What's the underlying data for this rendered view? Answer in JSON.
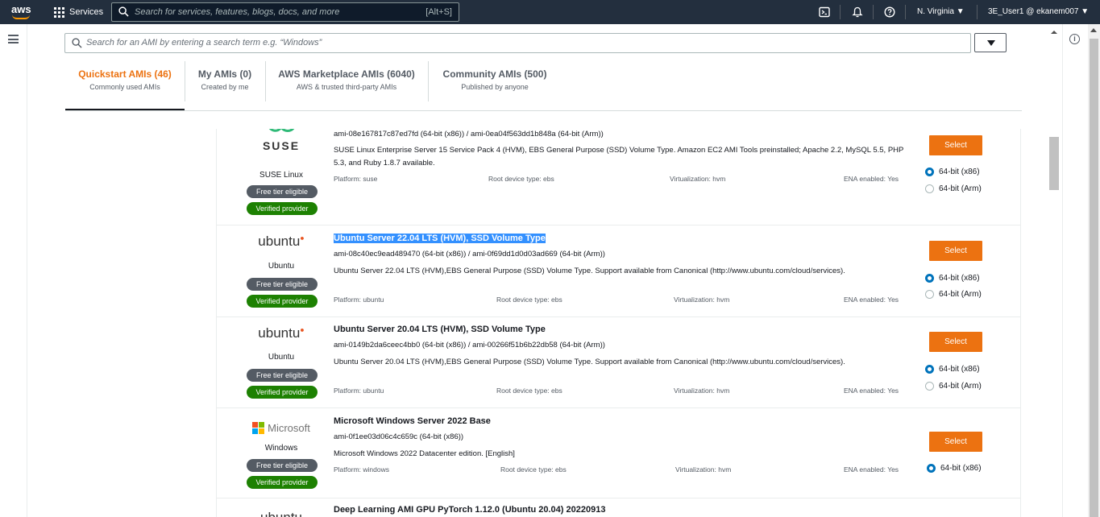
{
  "nav": {
    "services_label": "Services",
    "search_placeholder": "Search for services, features, blogs, docs, and more",
    "search_shortcut": "[Alt+S]",
    "region": "N. Virginia",
    "user": "3E_User1 @ ekanem007",
    "logo_text": "aws"
  },
  "ami_search": {
    "placeholder": "Search for an AMI by entering a search term e.g. “Windows”"
  },
  "tabs": [
    {
      "title": "Quickstart AMIs (46)",
      "subtitle": "Commonly used AMIs"
    },
    {
      "title": "My AMIs (0)",
      "subtitle": "Created by me"
    },
    {
      "title": "AWS Marketplace AMIs (6040)",
      "subtitle": "AWS & trusted third-party AMIs"
    },
    {
      "title": "Community AMIs (500)",
      "subtitle": "Published by anyone"
    }
  ],
  "amis": [
    {
      "logo_text": "SUSE",
      "os": "SUSE Linux",
      "badges": [
        "Free tier eligible",
        "Verified provider"
      ],
      "id": "ami-08e167817c87ed7fd (64-bit (x86)) / ami-0ea04f563dd1b848a (64-bit (Arm))",
      "desc": "SUSE Linux Enterprise Server 15 Service Pack 4 (HVM), EBS General Purpose (SSD) Volume Type. Amazon EC2 AMI Tools preinstalled; Apache 2.2, MySQL 5.5, PHP 5.3, and Ruby 1.8.7 available.",
      "platform": "Platform: suse",
      "root": "Root device type: ebs",
      "virt": "Virtualization: hvm",
      "ena": "ENA enabled: Yes",
      "select": "Select",
      "arch": [
        "64-bit (x86)",
        "64-bit (Arm)"
      ]
    },
    {
      "logo_text": "ubuntu",
      "os": "Ubuntu",
      "badges": [
        "Free tier eligible",
        "Verified provider"
      ],
      "title": "Ubuntu Server 22.04 LTS (HVM), SSD Volume Type",
      "id": "ami-08c40ec9ead489470 (64-bit (x86)) / ami-0f69dd1d0d03ad669 (64-bit (Arm))",
      "desc": "Ubuntu Server 22.04 LTS (HVM),EBS General Purpose (SSD) Volume Type. Support available from Canonical (http://www.ubuntu.com/cloud/services).",
      "platform": "Platform: ubuntu",
      "root": "Root device type: ebs",
      "virt": "Virtualization: hvm",
      "ena": "ENA enabled: Yes",
      "select": "Select",
      "arch": [
        "64-bit (x86)",
        "64-bit (Arm)"
      ]
    },
    {
      "logo_text": "ubuntu",
      "os": "Ubuntu",
      "badges": [
        "Free tier eligible",
        "Verified provider"
      ],
      "title": "Ubuntu Server 20.04 LTS (HVM), SSD Volume Type",
      "id": "ami-0149b2da6ceec4bb0 (64-bit (x86)) / ami-00266f51b6b22db58 (64-bit (Arm))",
      "desc": "Ubuntu Server 20.04 LTS (HVM),EBS General Purpose (SSD) Volume Type. Support available from Canonical (http://www.ubuntu.com/cloud/services).",
      "platform": "Platform: ubuntu",
      "root": "Root device type: ebs",
      "virt": "Virtualization: hvm",
      "ena": "ENA enabled: Yes",
      "select": "Select",
      "arch": [
        "64-bit (x86)",
        "64-bit (Arm)"
      ]
    },
    {
      "logo_text": "Microsoft",
      "os": "Windows",
      "badges": [
        "Free tier eligible",
        "Verified provider"
      ],
      "title": "Microsoft Windows Server 2022 Base",
      "id": "ami-0f1ee03d06c4c659c (64-bit (x86))",
      "desc": "Microsoft Windows 2022 Datacenter edition. [English]",
      "platform": "Platform: windows",
      "root": "Root device type: ebs",
      "virt": "Virtualization: hvm",
      "ena": "ENA enabled: Yes",
      "select": "Select",
      "arch": [
        "64-bit (x86)"
      ]
    },
    {
      "title": "Deep Learning AMI GPU PyTorch 1.12.0 (Ubuntu 20.04) 20220913"
    }
  ],
  "colors": {
    "accent": "#ec7211",
    "nav_bg": "#232f3e",
    "verified": "#1d8102",
    "radio": "#0073bb"
  }
}
